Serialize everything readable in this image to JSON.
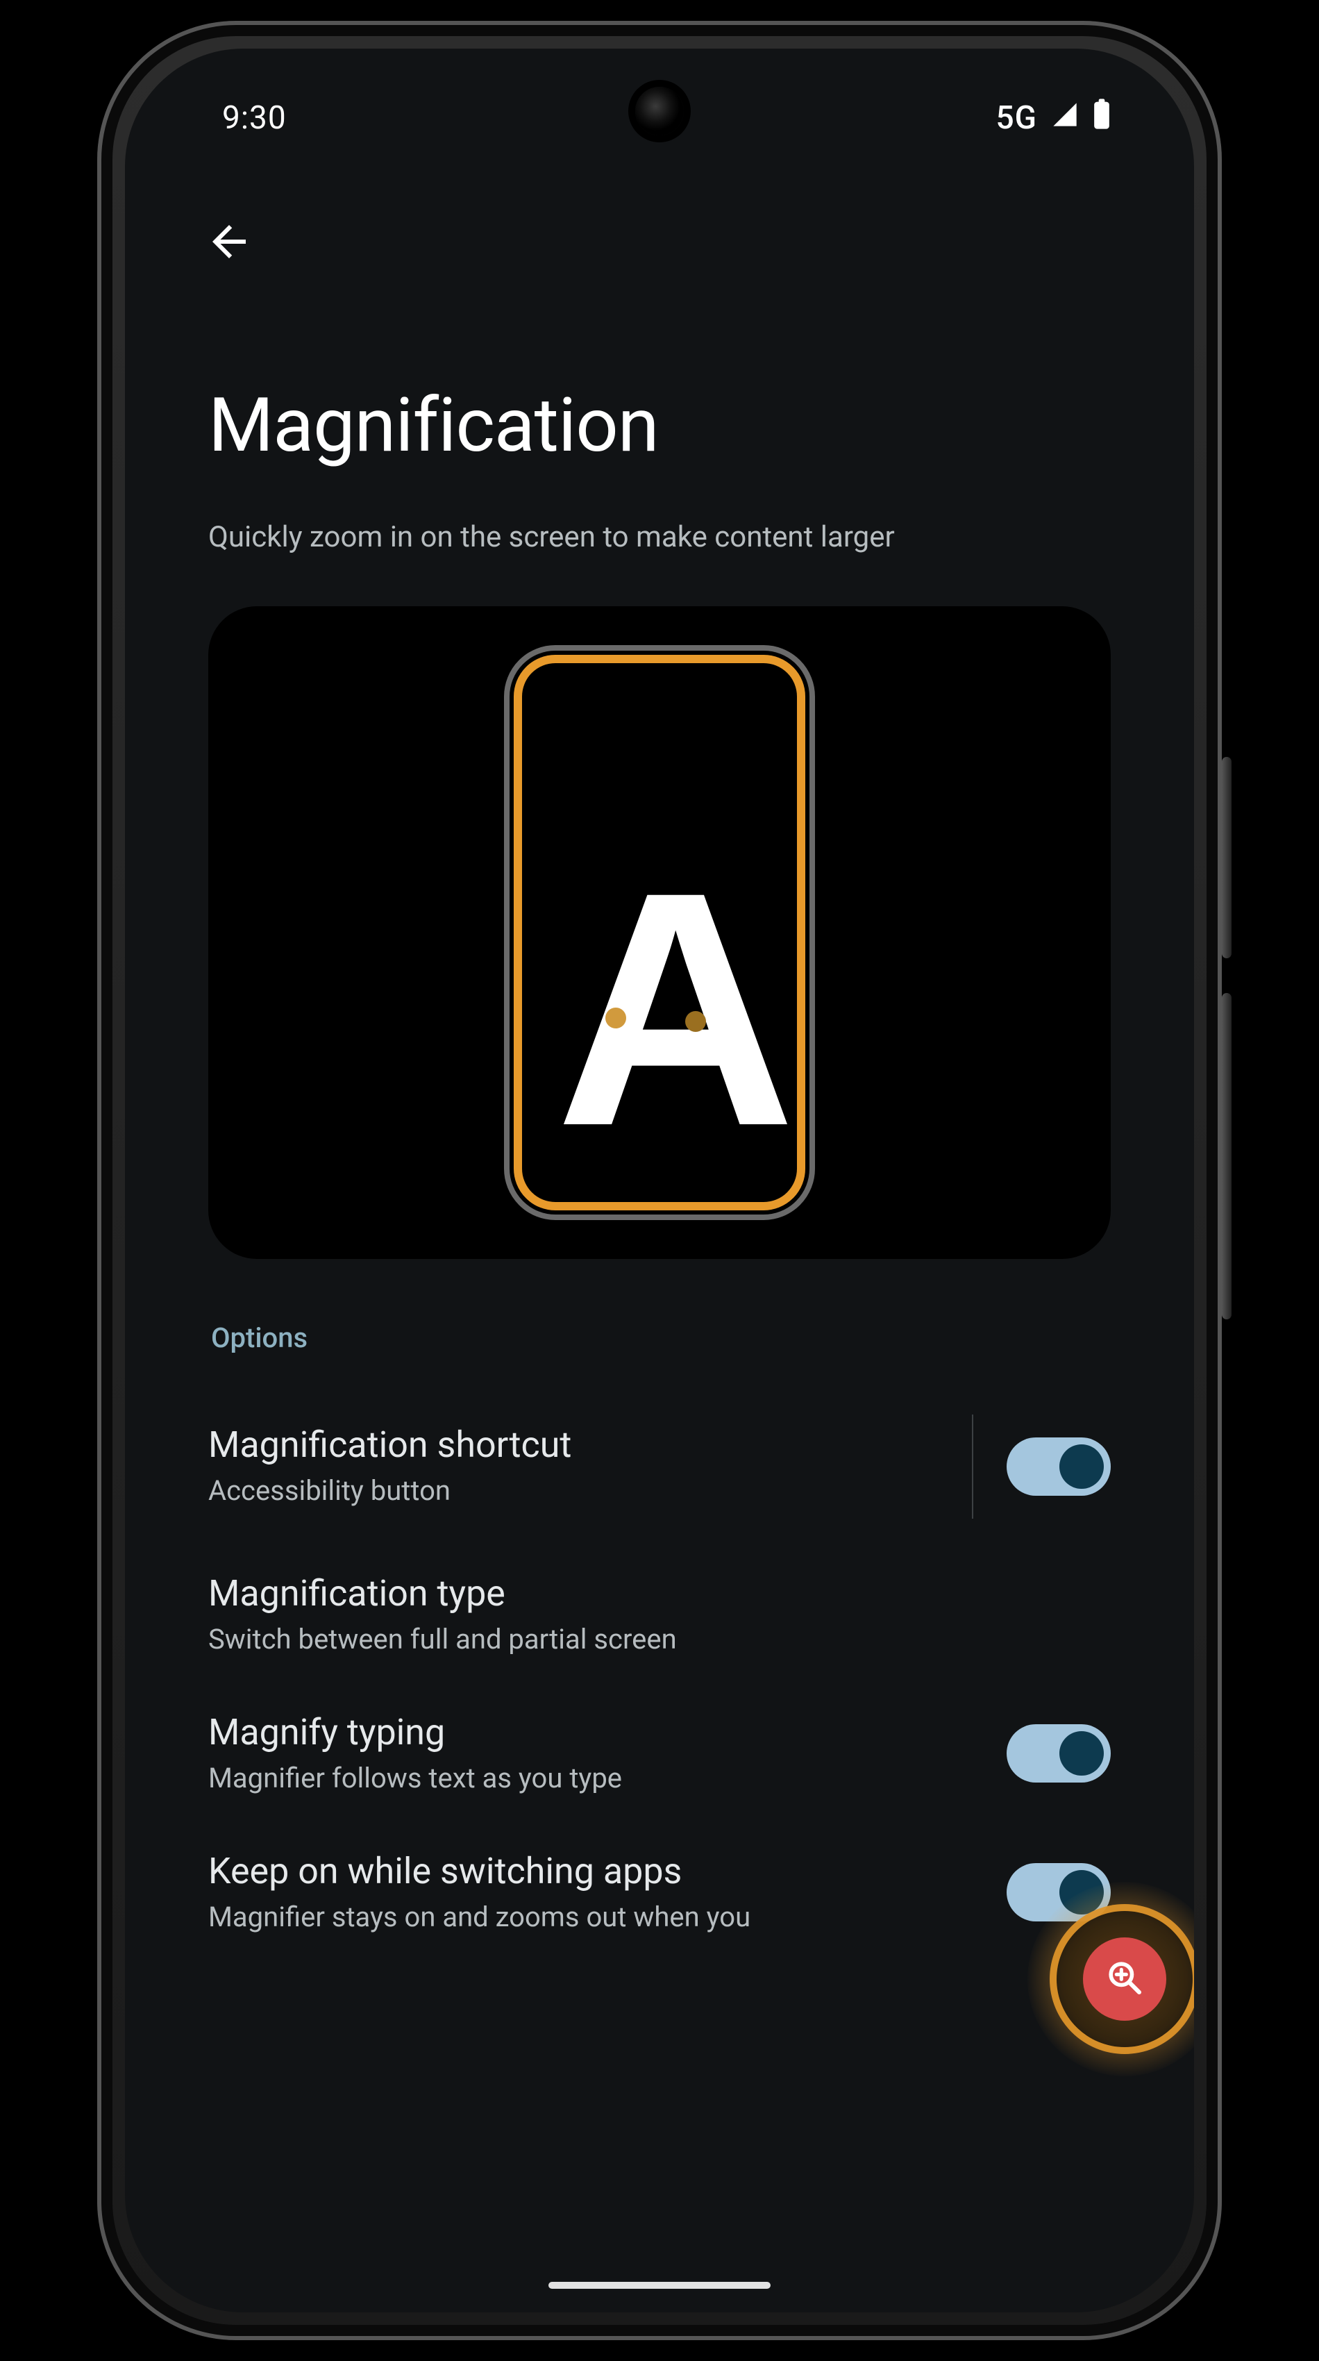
{
  "status_bar": {
    "time": "9:30",
    "network_label": "5G"
  },
  "header": {
    "back_icon": "arrow-back"
  },
  "page": {
    "title": "Magnification",
    "subtitle": "Quickly zoom in on the screen to make content larger"
  },
  "hero": {
    "glyph": "A"
  },
  "section_label": "Options",
  "options": [
    {
      "title": "Magnification shortcut",
      "desc": "Accessibility button",
      "toggle": true,
      "has_divider": true
    },
    {
      "title": "Magnification type",
      "desc": "Switch between full and partial screen",
      "toggle": null
    },
    {
      "title": "Magnify typing",
      "desc": "Magnifier follows text as you type",
      "toggle": true
    },
    {
      "title": "Keep on while switching apps",
      "desc": "Magnifier stays on and zooms out when you",
      "toggle": true
    }
  ],
  "fab": {
    "icon": "zoom-in"
  }
}
